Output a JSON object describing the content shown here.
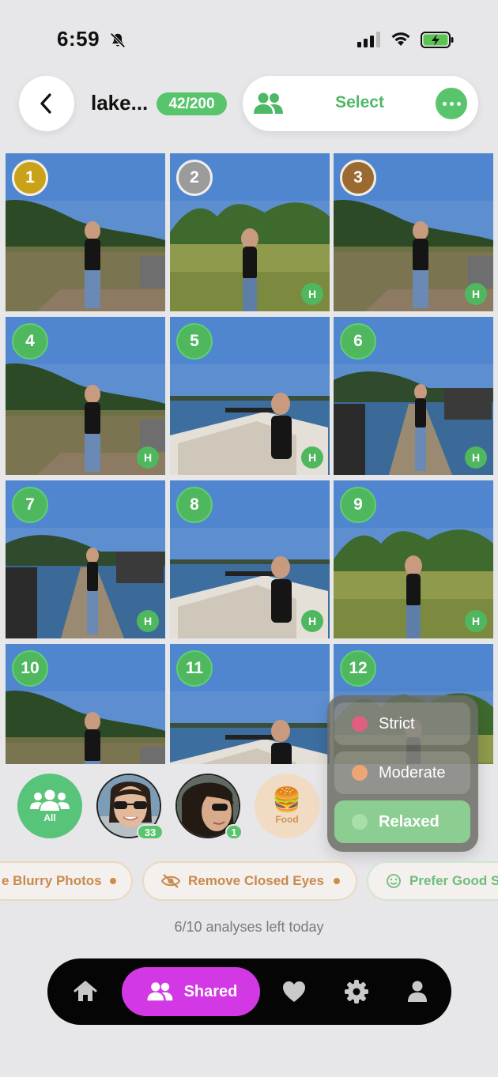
{
  "status_bar": {
    "time": "6:59"
  },
  "header": {
    "album_title": "lake...",
    "photo_count": "42/200",
    "select_label": "Select"
  },
  "photos": [
    {
      "rank": "1",
      "badge_style": "gold",
      "quality": ""
    },
    {
      "rank": "2",
      "badge_style": "silver",
      "quality": "H"
    },
    {
      "rank": "3",
      "badge_style": "bronze",
      "quality": "H"
    },
    {
      "rank": "4",
      "badge_style": "green",
      "quality": "H"
    },
    {
      "rank": "5",
      "badge_style": "green",
      "quality": "H"
    },
    {
      "rank": "6",
      "badge_style": "green",
      "quality": "H"
    },
    {
      "rank": "7",
      "badge_style": "green",
      "quality": "H"
    },
    {
      "rank": "8",
      "badge_style": "green",
      "quality": "H"
    },
    {
      "rank": "9",
      "badge_style": "green",
      "quality": "H"
    },
    {
      "rank": "10",
      "badge_style": "green",
      "quality": ""
    },
    {
      "rank": "11",
      "badge_style": "green",
      "quality": ""
    },
    {
      "rank": "12",
      "badge_style": "green",
      "quality": ""
    }
  ],
  "faces": {
    "all_label": "All",
    "person1_count": "33",
    "person2_count": "1",
    "food_emoji": "🍔",
    "food_label": "Food"
  },
  "strictness": {
    "options": [
      {
        "label": "Strict",
        "color": "#e05f7e"
      },
      {
        "label": "Moderate",
        "color": "#eda673"
      },
      {
        "label": "Relaxed",
        "color": "#a8dea8"
      }
    ],
    "selected": "Relaxed"
  },
  "filters": [
    {
      "label": "Remove Blurry Photos",
      "visible_label": "e Blurry Photos"
    },
    {
      "label": "Remove Closed Eyes"
    },
    {
      "label": "Prefer Good S",
      "visible_label": "Prefer Good S"
    }
  ],
  "analyses_text": "6/10 analyses left today",
  "tabbar": {
    "items": [
      "home-icon",
      "Shared",
      "heart-icon",
      "gear-icon",
      "profile-icon"
    ],
    "shared_label": "Shared",
    "active": "Shared"
  }
}
